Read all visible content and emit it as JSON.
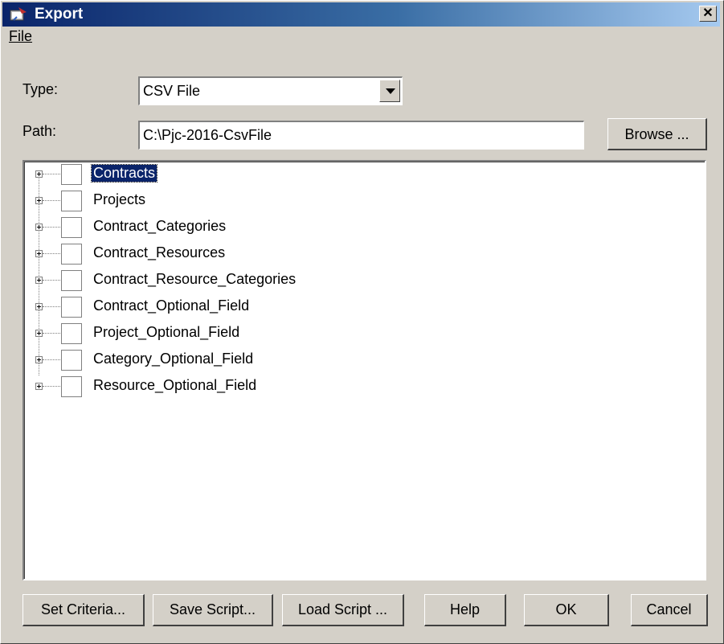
{
  "window": {
    "title": "Export"
  },
  "menubar": {
    "items": [
      {
        "label": "File"
      }
    ]
  },
  "form": {
    "type_label": "Type:",
    "type_value": "CSV File",
    "path_label": "Path:",
    "path_value": "C:\\Pjc-2016-CsvFile",
    "browse_label": "Browse ..."
  },
  "tree": {
    "items": [
      {
        "label": "Contracts",
        "checked": false,
        "selected": true
      },
      {
        "label": "Projects",
        "checked": false
      },
      {
        "label": "Contract_Categories",
        "checked": false
      },
      {
        "label": "Contract_Resources",
        "checked": false
      },
      {
        "label": "Contract_Resource_Categories",
        "checked": false
      },
      {
        "label": "Contract_Optional_Field",
        "checked": false
      },
      {
        "label": "Project_Optional_Field",
        "checked": false
      },
      {
        "label": "Category_Optional_Field",
        "checked": false
      },
      {
        "label": "Resource_Optional_Field",
        "checked": false
      }
    ]
  },
  "buttons": {
    "set_criteria": "Set Criteria...",
    "save_script": "Save Script...",
    "load_script": "Load Script ...",
    "help": "Help",
    "ok": "OK",
    "cancel": "Cancel"
  },
  "colors": {
    "titlebar_start": "#0a246a",
    "titlebar_end": "#a6caf0",
    "face": "#d4d0c8",
    "selection": "#0a246a"
  }
}
